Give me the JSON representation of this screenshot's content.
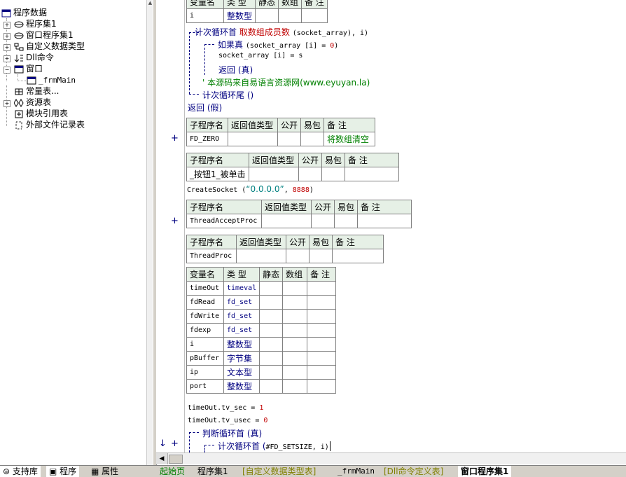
{
  "tree": {
    "root": "程序数据",
    "items": [
      {
        "label": "程序集1",
        "icon": "module-icon"
      },
      {
        "label": "窗口程序集1",
        "icon": "module-icon"
      },
      {
        "label": "自定义数据类型",
        "icon": "datatype-icon"
      },
      {
        "label": "Dll命令",
        "icon": "dll-icon"
      },
      {
        "label": "窗口",
        "icon": "window-icon"
      },
      {
        "label": "_frmMain",
        "icon": "form-icon"
      },
      {
        "label": "常量表...",
        "icon": "constant-icon"
      },
      {
        "label": "资源表",
        "icon": "resource-icon"
      },
      {
        "label": "模块引用表",
        "icon": "module-ref-icon"
      },
      {
        "label": "外部文件记录表",
        "icon": "file-icon"
      }
    ]
  },
  "left_tabs": {
    "support": "支持库",
    "program": "程序",
    "property": "属性"
  },
  "editor_tabs": [
    "起始页",
    "程序集1",
    "[自定义数据类型表]",
    "_frmMain",
    "[Dll命令定义表]",
    "窗口程序集1"
  ],
  "var_headers": {
    "name": "变量名",
    "type": "类 型",
    "static": "静态",
    "array": "数组",
    "note": "备 注"
  },
  "sub_headers": {
    "name": "子程序名",
    "ret": "返回值类型",
    "public": "公开",
    "easy": "易包",
    "note": "备 注"
  },
  "top_var": {
    "name": "i",
    "type": "整数型"
  },
  "code": {
    "loop_head_kw": "计次循环首",
    "loop_head_fn": "取数组成员数",
    "loop_head_arg": "(socket_array), i)",
    "if_kw": "如果真",
    "if_cond_a": "(socket_array [i] = ",
    "if_cond_b": "0",
    "if_cond_c": ")",
    "assign": "socket_array [i] = s",
    "return_true": "返回 (真)",
    "comment": "' 本源码来自易语言资源网(www.eyuyan.la)",
    "loop_tail": "计次循环尾 ()",
    "return_false": "返回 (假)"
  },
  "sub_fd_zero": {
    "name": "FD_ZERO",
    "note": "将数组清空"
  },
  "sub_btn": {
    "name": "_按钮1_被单击"
  },
  "create_socket": {
    "a": "CreateSocket (",
    "b": "“0.0.0.0”",
    "c": ", ",
    "d": "8888",
    ")": ")"
  },
  "sub_accept": {
    "name": "ThreadAcceptProc"
  },
  "sub_proc": {
    "name": "ThreadProc"
  },
  "proc_vars": [
    {
      "name": "timeOut",
      "type": "timeval"
    },
    {
      "name": "fdRead",
      "type": "fd_set"
    },
    {
      "name": "fdWrite",
      "type": "fd_set"
    },
    {
      "name": "fdexp",
      "type": "fd_set"
    },
    {
      "name": "i",
      "type": "整数型"
    },
    {
      "name": "pBuffer",
      "type": "字节集"
    },
    {
      "name": "ip",
      "type": "文本型"
    },
    {
      "name": "port",
      "type": "整数型"
    }
  ],
  "tail_code": {
    "l1a": "timeOut.tv_sec = ",
    "l1b": "1",
    "l2a": "timeOut.tv_usec = ",
    "l2b": "0",
    "l3": "判断循环首 (真)",
    "l4a": "计次循环首 (",
    "l4b": "#FD_SETSIZE, i)"
  },
  "gutter": {
    "plus": "+",
    "down": "↓"
  },
  "colors": {
    "keyword": "#000080",
    "comment": "#008000",
    "number": "#c00000",
    "string": "#008080",
    "header_bg": "#e6f0e6"
  }
}
